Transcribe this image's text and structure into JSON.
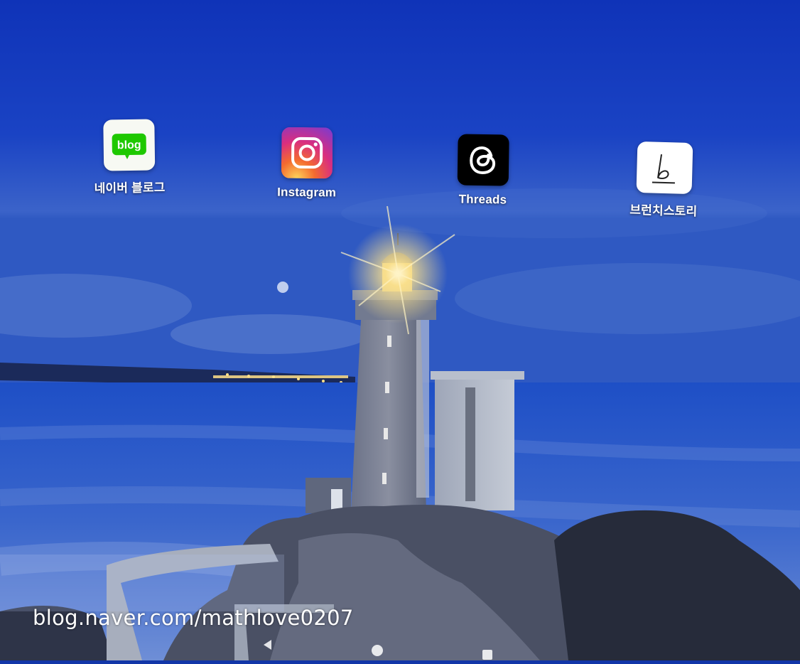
{
  "apps": [
    {
      "id": "naver-blog",
      "label": "네이버 블로그",
      "icon": "naver-blog-icon",
      "icon_text": "blog",
      "color": "#1ec800"
    },
    {
      "id": "instagram",
      "label": "Instagram",
      "icon": "instagram-icon"
    },
    {
      "id": "threads",
      "label": "Threads",
      "icon": "threads-icon",
      "color": "#000000"
    },
    {
      "id": "brunch-story",
      "label": "브런치스토리",
      "icon": "brunch-story-icon",
      "color": "#ffffff"
    }
  ],
  "watermark": "blog.naver.com/mathlove0207",
  "navigation": [
    {
      "icon": "back-triangle-icon"
    },
    {
      "icon": "home-circle-icon"
    },
    {
      "icon": "recents-square-icon"
    }
  ]
}
